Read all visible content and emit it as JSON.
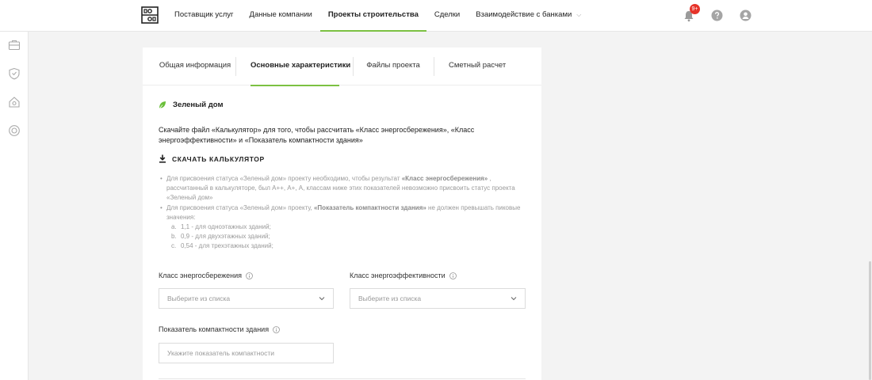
{
  "nav": {
    "items": [
      {
        "label": "Поставщик услуг"
      },
      {
        "label": "Данные компании"
      },
      {
        "label": "Проекты строительства",
        "active": true
      },
      {
        "label": "Сделки"
      },
      {
        "label": "Взаимодействие с банками",
        "dropdown": true
      }
    ],
    "notifications_badge": "9+",
    "icons": [
      "bell-icon",
      "help-icon",
      "user-icon"
    ]
  },
  "sidebar": {
    "icons": [
      "briefcase-icon",
      "shield-icon",
      "house-icon",
      "coin-icon"
    ]
  },
  "tabs": [
    {
      "label": "Общая информация"
    },
    {
      "label": "Основные характеристики",
      "active": true
    },
    {
      "label": "Файлы проекта"
    },
    {
      "label": "Сметный расчет"
    }
  ],
  "section": {
    "title": "Зеленый дом",
    "description": "Скачайте файл «Калькулятор» для того, чтобы рассчитать «Класс энергосбережения», «Класс энергоэффективности» и «Показатель компактности здания»",
    "download_label": "СКАЧАТЬ КАЛЬКУЛЯТОР"
  },
  "notes": {
    "item1_pre": "Для присвоения статуса «Зеленый дом» проекту необходимо, чтобы результат ",
    "item1_bold": "«Класс энергосбережения»",
    "item1_post": " , рассчитанный в калькуляторе, был А++, А+, А, классам ниже этих показателей невозможно присвоить статус проекта «Зеленый дом»",
    "item2_pre": "Для присвоения статуса «Зеленый дом» проекту, ",
    "item2_bold": "«Показатель компактности здания»",
    "item2_post": " не должен превышать пиковые значения:",
    "sub": [
      {
        "n": "a.",
        "text": "1,1 - для одноэтажных зданий;"
      },
      {
        "n": "b.",
        "text": "0,9 - для двухэтажных зданий;"
      },
      {
        "n": "c.",
        "text": "0,54 - для трехэтажных зданий;"
      }
    ]
  },
  "form": {
    "energy_saving_label": "Класс энергосбережения",
    "energy_saving_placeholder": "Выберите из списка",
    "energy_efficiency_label": "Класс энергоэффективности",
    "energy_efficiency_placeholder": "Выберите из списка",
    "compactness_label": "Показатель компактности здания",
    "compactness_placeholder": "Укажите показатель компактности"
  },
  "colors": {
    "accent": "#7cc142",
    "badge": "#e63329"
  }
}
